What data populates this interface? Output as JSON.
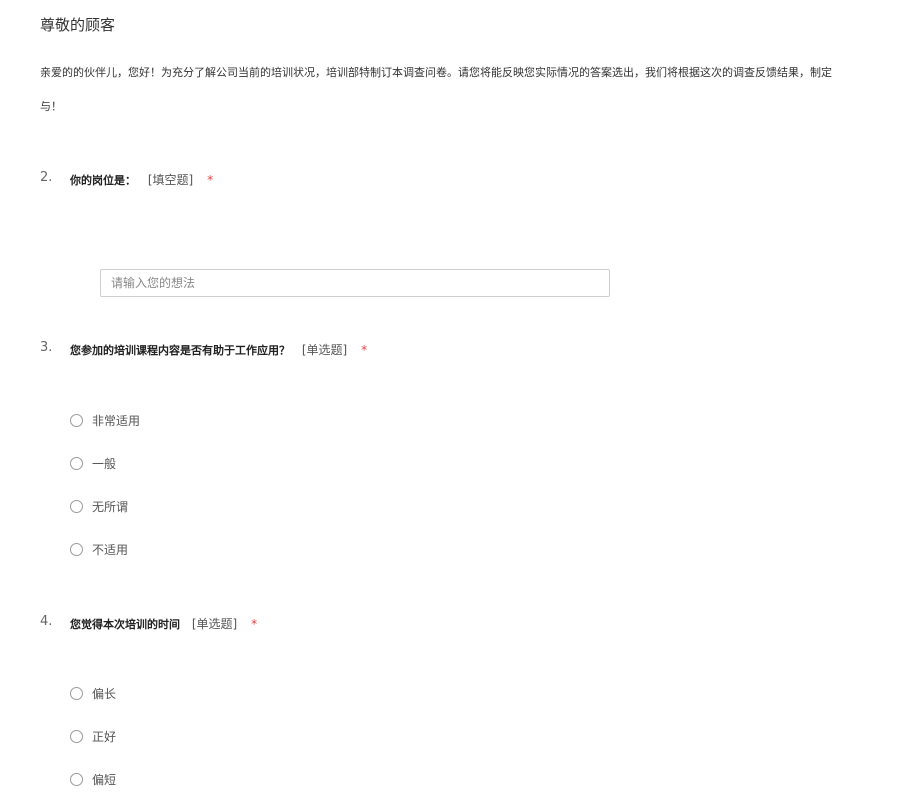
{
  "greeting": "尊敬的顾客",
  "intro": {
    "line1": "亲爱的的伙伴儿，您好！为充分了解公司当前的培训状况，培训部特制订本调查问卷。请您将能反映您实际情况的答案选出，我们将根据这次的调查反馈结果，制定",
    "line2": "与！"
  },
  "questions": [
    {
      "number": "2.",
      "title": "你的岗位是：",
      "type": "[填空题]",
      "required": "*",
      "input": {
        "placeholder": "请输入您的想法",
        "value": ""
      }
    },
    {
      "number": "3.",
      "title": "您参加的培训课程内容是否有助于工作应用？",
      "type": "[单选题]",
      "required": "*",
      "options": [
        "非常适用",
        "一般",
        "无所谓",
        "不适用"
      ]
    },
    {
      "number": "4.",
      "title": "您觉得本次培训的时间",
      "type": "[单选题]",
      "required": "*",
      "options": [
        "偏长",
        "正好",
        "偏短"
      ]
    }
  ]
}
